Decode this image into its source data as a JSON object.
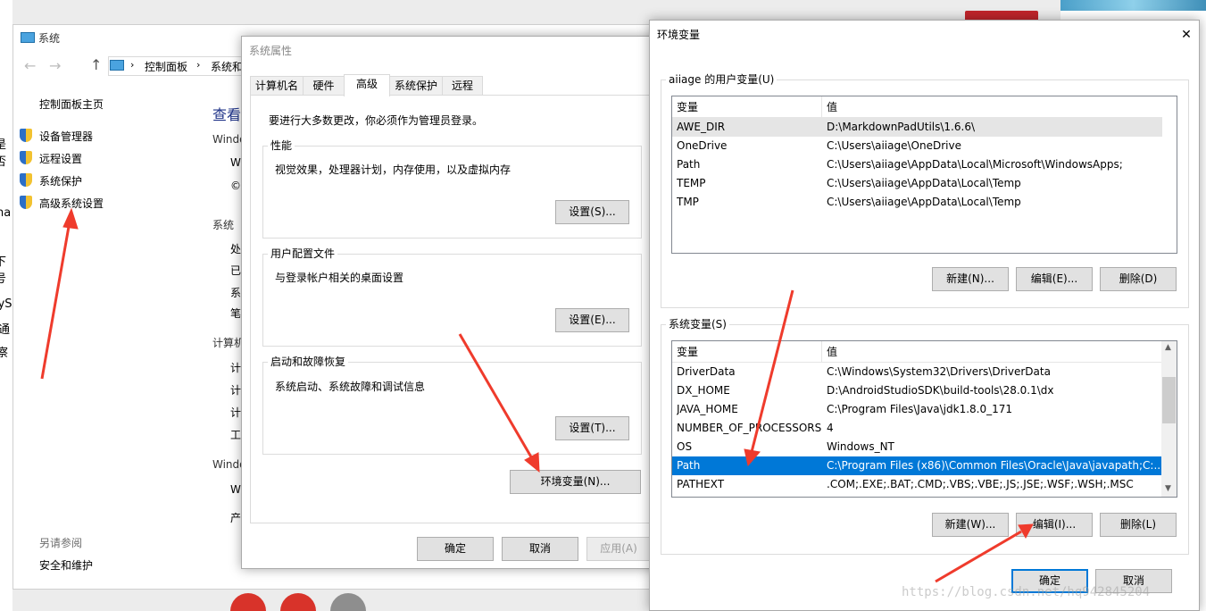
{
  "left_partial": [
    "是否",
    "na",
    "下号",
    "lyS",
    "通",
    "察"
  ],
  "system_window": {
    "title": "系统",
    "breadcrumb": [
      "控制面板",
      "系统和"
    ],
    "sidebar_home": "控制面板主页",
    "sidebar_links": [
      "设备管理器",
      "远程设置",
      "系统保护",
      "高级系统设置"
    ],
    "heading": "查看",
    "content_labels": [
      "Windo",
      "Wi",
      "©",
      "系统",
      "处",
      "已",
      "系",
      "笔",
      "计算机",
      "计",
      "计",
      "计",
      "工",
      "Windo",
      "Wi",
      "产"
    ],
    "see_also": "另请参阅",
    "see_also_link": "安全和维护"
  },
  "sysprops": {
    "title": "系统属性",
    "tabs": [
      "计算机名",
      "硬件",
      "高级",
      "系统保护",
      "远程"
    ],
    "active_tab": "高级",
    "admin_note": "要进行大多数更改，你必须作为管理员登录。",
    "perf": {
      "label": "性能",
      "desc": "视觉效果，处理器计划，内存使用，以及虚拟内存",
      "btn": "设置(S)..."
    },
    "profile": {
      "label": "用户配置文件",
      "desc": "与登录帐户相关的桌面设置",
      "btn": "设置(E)..."
    },
    "startup": {
      "label": "启动和故障恢复",
      "desc": "系统启动、系统故障和调试信息",
      "btn": "设置(T)..."
    },
    "env_btn": "环境变量(N)...",
    "ok": "确定",
    "cancel": "取消",
    "apply": "应用(A)"
  },
  "envvars": {
    "title": "环境变量",
    "close": "✕",
    "user_label": "aiiage 的用户变量(U)",
    "col_var": "变量",
    "col_val": "值",
    "user_rows": [
      [
        "AWE_DIR",
        "D:\\MarkdownPadUtils\\1.6.6\\"
      ],
      [
        "OneDrive",
        "C:\\Users\\aiiage\\OneDrive"
      ],
      [
        "Path",
        "C:\\Users\\aiiage\\AppData\\Local\\Microsoft\\WindowsApps;"
      ],
      [
        "TEMP",
        "C:\\Users\\aiiage\\AppData\\Local\\Temp"
      ],
      [
        "TMP",
        "C:\\Users\\aiiage\\AppData\\Local\\Temp"
      ]
    ],
    "user_btns": [
      "新建(N)...",
      "编辑(E)...",
      "删除(D)"
    ],
    "sys_label": "系统变量(S)",
    "sys_rows": [
      [
        "DriverData",
        "C:\\Windows\\System32\\Drivers\\DriverData"
      ],
      [
        "DX_HOME",
        "D:\\AndroidStudioSDK\\build-tools\\28.0.1\\dx"
      ],
      [
        "JAVA_HOME",
        "C:\\Program Files\\Java\\jdk1.8.0_171"
      ],
      [
        "NUMBER_OF_PROCESSORS",
        "4"
      ],
      [
        "OS",
        "Windows_NT"
      ],
      [
        "Path",
        "C:\\Program Files (x86)\\Common Files\\Oracle\\Java\\javapath;C:..."
      ],
      [
        "PATHEXT",
        ".COM;.EXE;.BAT;.CMD;.VBS;.VBE;.JS;.JSE;.WSF;.WSH;.MSC"
      ]
    ],
    "sys_selected_index": 5,
    "sys_btns": [
      "新建(W)...",
      "编辑(I)...",
      "删除(L)"
    ],
    "ok": "确定",
    "cancel": "取消"
  },
  "watermark": "https://blog.csdn.net/hq942845204",
  "colors": {
    "accent": "#0078d7",
    "arrow": "#ef3b2c"
  }
}
